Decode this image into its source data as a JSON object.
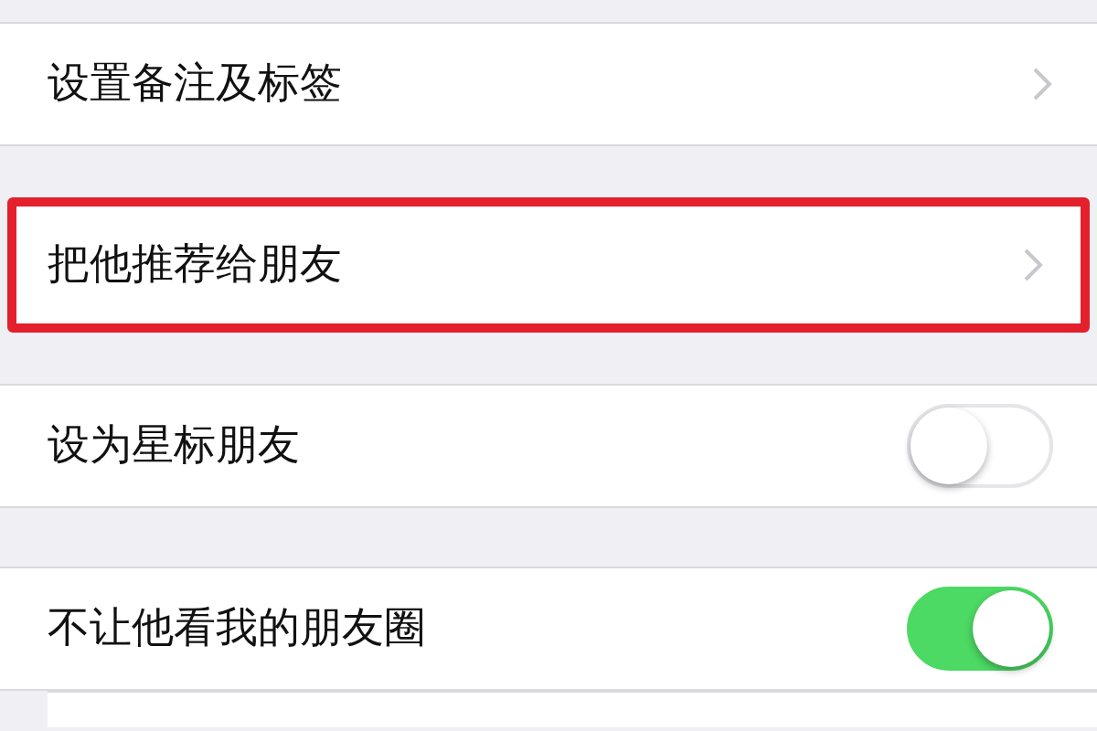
{
  "settings": [
    {
      "label": "设置备注及标签",
      "kind": "link",
      "highlighted": false
    },
    {
      "label": "把他推荐给朋友",
      "kind": "link",
      "highlighted": true
    },
    {
      "label": "设为星标朋友",
      "kind": "toggle",
      "on": false,
      "highlighted": false
    },
    {
      "label": "不让他看我的朋友圈",
      "kind": "toggle",
      "on": true,
      "highlighted": false
    }
  ]
}
